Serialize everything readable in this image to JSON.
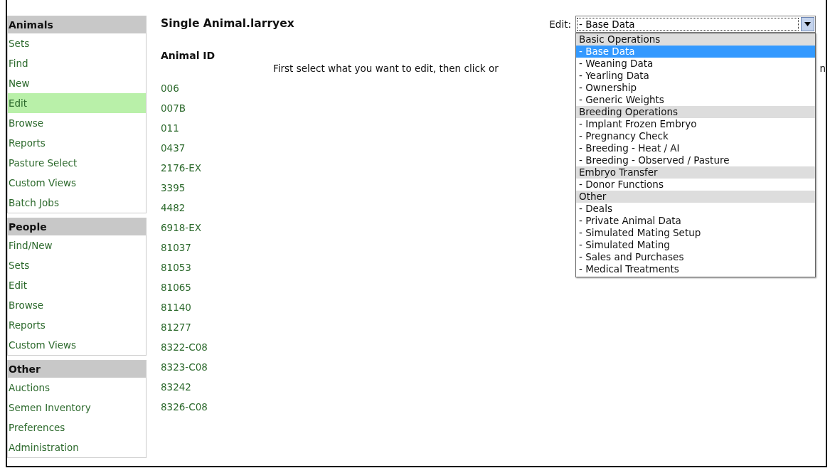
{
  "sidebar": {
    "sections": [
      {
        "title": "Animals",
        "items": [
          {
            "label": "Sets",
            "selected": false
          },
          {
            "label": "Find",
            "selected": false
          },
          {
            "label": "New",
            "selected": false
          },
          {
            "label": "Edit",
            "selected": true
          },
          {
            "label": "Browse",
            "selected": false
          },
          {
            "label": "Reports",
            "selected": false
          },
          {
            "label": "Pasture Select",
            "selected": false
          },
          {
            "label": "Custom Views",
            "selected": false
          },
          {
            "label": "Batch Jobs",
            "selected": false
          }
        ]
      },
      {
        "title": "People",
        "items": [
          {
            "label": "Find/New",
            "selected": false
          },
          {
            "label": "Sets",
            "selected": false
          },
          {
            "label": "Edit",
            "selected": false
          },
          {
            "label": "Browse",
            "selected": false
          },
          {
            "label": "Reports",
            "selected": false
          },
          {
            "label": "Custom Views",
            "selected": false
          }
        ]
      },
      {
        "title": "Other",
        "items": [
          {
            "label": "Auctions",
            "selected": false
          },
          {
            "label": "Semen Inventory",
            "selected": false
          },
          {
            "label": "Preferences",
            "selected": false
          },
          {
            "label": "Administration",
            "selected": false
          }
        ]
      }
    ]
  },
  "title": "Single Animal.larryex",
  "edit_select": {
    "label": "Edit:",
    "value": "- Base Data",
    "expanded": true,
    "groups": [
      {
        "label": "Basic Operations",
        "options": [
          {
            "label": "- Base Data",
            "selected": true
          },
          {
            "label": "- Weaning Data",
            "selected": false
          },
          {
            "label": "- Yearling Data",
            "selected": false
          },
          {
            "label": "- Ownership",
            "selected": false
          },
          {
            "label": "- Generic Weights",
            "selected": false
          }
        ]
      },
      {
        "label": "Breeding Operations",
        "options": [
          {
            "label": "- Implant Frozen Embryo",
            "selected": false
          },
          {
            "label": "- Pregnancy Check",
            "selected": false
          },
          {
            "label": "- Breeding - Heat / AI",
            "selected": false
          },
          {
            "label": "- Breeding - Observed / Pasture",
            "selected": false
          }
        ]
      },
      {
        "label": "Embryo Transfer",
        "options": [
          {
            "label": "- Donor Functions",
            "selected": false
          }
        ]
      },
      {
        "label": "Other",
        "options": [
          {
            "label": "- Deals",
            "selected": false
          },
          {
            "label": "- Private Animal Data",
            "selected": false
          },
          {
            "label": "- Simulated Mating Setup",
            "selected": false
          },
          {
            "label": "- Simulated Mating",
            "selected": false
          },
          {
            "label": "- Sales and Purchases",
            "selected": false
          },
          {
            "label": "- Medical Treatments",
            "selected": false
          }
        ]
      }
    ]
  },
  "animal_list": {
    "heading": "Animal ID",
    "ids": [
      "006",
      "007B",
      "011",
      "0437",
      "2176-EX",
      "3395",
      "4482",
      "6918-EX",
      "81037",
      "81053",
      "81065",
      "81140",
      "81277",
      "8322-C08",
      "8323-C08",
      "83242",
      "8326-C08"
    ]
  },
  "instruction": {
    "visible_start": "First select what you want to edit, then click or",
    "visible_end": "n"
  }
}
